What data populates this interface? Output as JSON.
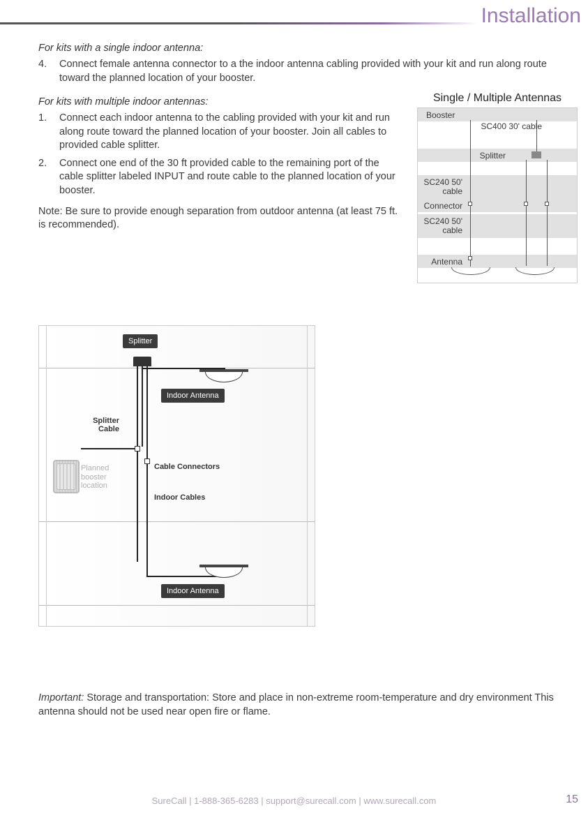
{
  "header": {
    "section_title": "Installation"
  },
  "body": {
    "lead_single": "For kits with a single indoor antenna:",
    "step4_num": "4.",
    "step4_text": "Connect female antenna connector to a the indoor antenna cabling provided with your kit and run along route toward the planned location of your booster.",
    "lead_multi": "For kits with multiple indoor antennas:",
    "step1_num": "1.",
    "step1_text": "Connect each indoor antenna to the cabling provided with your kit and run along route toward the planned location of your booster. Join all cables to provided cable splitter.",
    "step2_num": "2.",
    "step2_text": "Connect one end of the 30 ft provided cable to the remaining port of the cable splitter labeled INPUT and route cable to the planned location of your booster.",
    "note": "Note: Be sure to provide enough separation from outdoor antenna (at least 75 ft. is recommended)."
  },
  "mini_diagram": {
    "title": "Single  /  Multiple Antennas",
    "rows": {
      "booster": "Booster",
      "sc400": "SC400 30' cable",
      "splitter": "Splitter",
      "sc240a": "SC240 50' cable",
      "connector": "Connector",
      "sc240b": "SC240 50' cable",
      "antenna": "Antenna"
    }
  },
  "big_diagram": {
    "splitter": "Splitter",
    "indoor_antenna": "Indoor Antenna",
    "splitter_cable": "Splitter Cable",
    "cable_connectors": "Cable Connectors",
    "indoor_cables": "Indoor Cables",
    "planned_booster": "Planned booster location"
  },
  "important": {
    "lead": "Important:",
    "text": "Storage and transportation: Store and place in non-extreme room-temperature and dry environment This antenna should not be used near open fire or flame."
  },
  "footer": {
    "line": "SureCall  |  1-888-365-6283  |  support@surecall.com  |  www.surecall.com",
    "page": "15"
  }
}
